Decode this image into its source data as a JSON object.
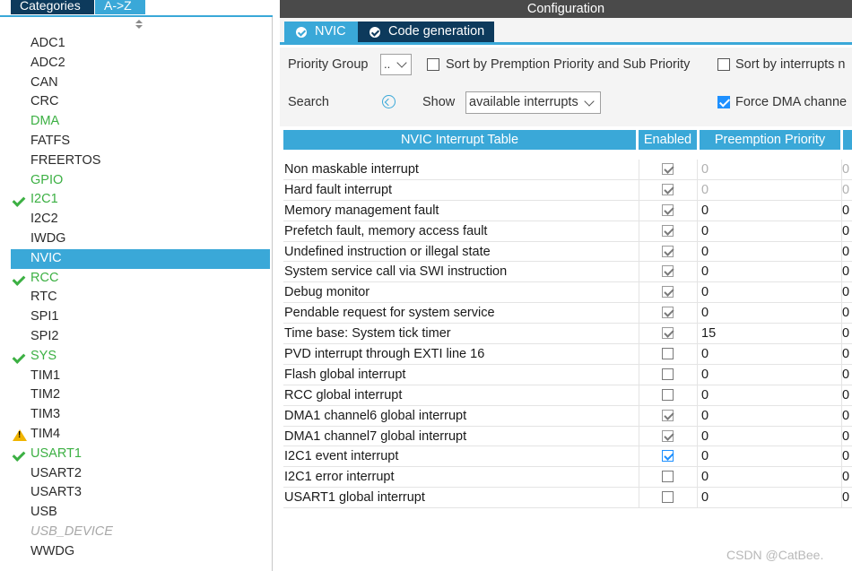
{
  "left_panel": {
    "tabs": {
      "categories": "Categories",
      "az": "A->Z"
    },
    "items": [
      {
        "label": "ADC1",
        "style": "normal",
        "mark": ""
      },
      {
        "label": "ADC2",
        "style": "normal",
        "mark": ""
      },
      {
        "label": "CAN",
        "style": "normal",
        "mark": ""
      },
      {
        "label": "CRC",
        "style": "normal",
        "mark": ""
      },
      {
        "label": "DMA",
        "style": "green",
        "mark": ""
      },
      {
        "label": "FATFS",
        "style": "normal",
        "mark": ""
      },
      {
        "label": "FREERTOS",
        "style": "normal",
        "mark": ""
      },
      {
        "label": "GPIO",
        "style": "green",
        "mark": ""
      },
      {
        "label": "I2C1",
        "style": "green",
        "mark": "check"
      },
      {
        "label": "I2C2",
        "style": "normal",
        "mark": ""
      },
      {
        "label": "IWDG",
        "style": "normal",
        "mark": ""
      },
      {
        "label": "NVIC",
        "style": "selected",
        "mark": ""
      },
      {
        "label": "RCC",
        "style": "green",
        "mark": "check"
      },
      {
        "label": "RTC",
        "style": "normal",
        "mark": ""
      },
      {
        "label": "SPI1",
        "style": "normal",
        "mark": ""
      },
      {
        "label": "SPI2",
        "style": "normal",
        "mark": ""
      },
      {
        "label": "SYS",
        "style": "green",
        "mark": "check"
      },
      {
        "label": "TIM1",
        "style": "normal",
        "mark": ""
      },
      {
        "label": "TIM2",
        "style": "normal",
        "mark": ""
      },
      {
        "label": "TIM3",
        "style": "normal",
        "mark": ""
      },
      {
        "label": "TIM4",
        "style": "normal",
        "mark": "warning"
      },
      {
        "label": "USART1",
        "style": "green",
        "mark": "check"
      },
      {
        "label": "USART2",
        "style": "normal",
        "mark": ""
      },
      {
        "label": "USART3",
        "style": "normal",
        "mark": ""
      },
      {
        "label": "USB",
        "style": "normal",
        "mark": ""
      },
      {
        "label": "USB_DEVICE",
        "style": "italic",
        "mark": ""
      },
      {
        "label": "WWDG",
        "style": "normal",
        "mark": ""
      }
    ]
  },
  "right_panel": {
    "title": "Configuration",
    "tabs": {
      "nvic": "NVIC",
      "code_generation": "Code generation"
    },
    "toolbar": {
      "priority_group_label": "Priority Group",
      "priority_group_value": "..",
      "sort_preemption_label": "Sort by Premption Priority and Sub Priority",
      "sort_interrupts_label": "Sort by interrupts n",
      "search_label": "Search",
      "show_label": "Show",
      "show_value": "available interrupts",
      "force_dma_label": "Force DMA channe"
    },
    "table": {
      "headers": {
        "name": "NVIC Interrupt Table",
        "enabled": "Enabled",
        "preemption": "Preemption Priority"
      },
      "rows": [
        {
          "name": "Non maskable interrupt",
          "enabled": "locked",
          "preemption": "0",
          "sub": "0",
          "disabled": true
        },
        {
          "name": "Hard fault interrupt",
          "enabled": "locked",
          "preemption": "0",
          "sub": "0",
          "disabled": true
        },
        {
          "name": "Memory management fault",
          "enabled": "locked",
          "preemption": "0",
          "sub": "0",
          "disabled": false
        },
        {
          "name": "Prefetch fault, memory access fault",
          "enabled": "locked",
          "preemption": "0",
          "sub": "0",
          "disabled": false
        },
        {
          "name": "Undefined instruction or illegal state",
          "enabled": "locked",
          "preemption": "0",
          "sub": "0",
          "disabled": false
        },
        {
          "name": "System service call via SWI instruction",
          "enabled": "locked",
          "preemption": "0",
          "sub": "0",
          "disabled": false
        },
        {
          "name": "Debug monitor",
          "enabled": "locked",
          "preemption": "0",
          "sub": "0",
          "disabled": false
        },
        {
          "name": "Pendable request for system service",
          "enabled": "locked",
          "preemption": "0",
          "sub": "0",
          "disabled": false
        },
        {
          "name": "Time base: System tick timer",
          "enabled": "locked",
          "preemption": "15",
          "sub": "0",
          "disabled": false
        },
        {
          "name": "PVD interrupt through EXTI line 16",
          "enabled": "off",
          "preemption": "0",
          "sub": "0",
          "disabled": false
        },
        {
          "name": "Flash global interrupt",
          "enabled": "off",
          "preemption": "0",
          "sub": "0",
          "disabled": false
        },
        {
          "name": "RCC global interrupt",
          "enabled": "off",
          "preemption": "0",
          "sub": "0",
          "disabled": false
        },
        {
          "name": "DMA1 channel6 global interrupt",
          "enabled": "locked",
          "preemption": "0",
          "sub": "0",
          "disabled": false
        },
        {
          "name": "DMA1 channel7 global interrupt",
          "enabled": "locked",
          "preemption": "0",
          "sub": "0",
          "disabled": false
        },
        {
          "name": "I2C1 event interrupt",
          "enabled": "on",
          "preemption": "0",
          "sub": "0",
          "disabled": false
        },
        {
          "name": "I2C1 error interrupt",
          "enabled": "off",
          "preemption": "0",
          "sub": "0",
          "disabled": false
        },
        {
          "name": "USART1 global interrupt",
          "enabled": "off",
          "preemption": "0",
          "sub": "0",
          "disabled": false
        }
      ]
    }
  },
  "watermark": "CSDN @CatBee."
}
